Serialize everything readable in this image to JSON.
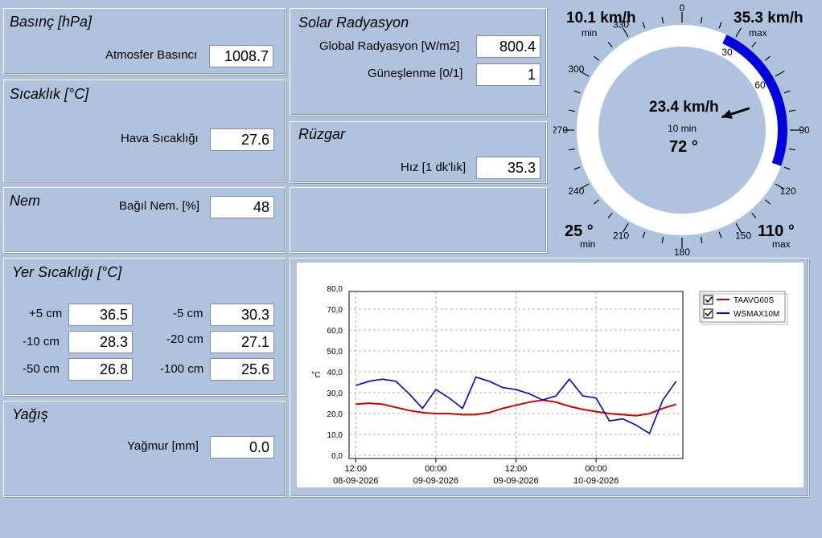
{
  "pressure": {
    "title": "Basınç [hPa]",
    "label": "Atmosfer Basıncı",
    "value": "1008.7"
  },
  "temperature": {
    "title": "Sıcaklık [°C]",
    "label": "Hava Sıcaklığı",
    "value": "27.6"
  },
  "humidity": {
    "title": "Nem",
    "label": "Bağıl Nem. [%]",
    "value": "48"
  },
  "solar": {
    "title": "Solar Radyasyon",
    "global_label": "Global Radyasyon [W/m2]",
    "global_value": "800.4",
    "sun_label": "Güneşlenme [0/1]",
    "sun_value": "1"
  },
  "wind": {
    "title": "Rüzgar",
    "speed_label": "Hız [1 dk'lık]",
    "speed_value": "35.3"
  },
  "soil": {
    "title": "Yer Sıcaklığı [°C]",
    "rows": [
      {
        "l1": "+5 cm",
        "v1": "36.5",
        "l2": "-5 cm",
        "v2": "30.3"
      },
      {
        "l1": "-10 cm",
        "v1": "28.3",
        "l2": "-20 cm",
        "v2": "27.1"
      },
      {
        "l1": "-50 cm",
        "v1": "26.8",
        "l2": "-100 cm",
        "v2": "25.6"
      }
    ]
  },
  "rain": {
    "title": "Yağış",
    "label": "Yağmur [mm]",
    "value": "0.0"
  },
  "gauge": {
    "min_speed": "10.1 km/h",
    "min_speed_caption": "min",
    "max_speed": "35.3 km/h",
    "max_speed_caption": "max",
    "current_speed": "23.4 km/h",
    "avg_caption": "10 min",
    "direction": "72 °",
    "min_dir": "25 °",
    "min_dir_caption": "min",
    "max_dir": "110 °",
    "max_dir_caption": "max",
    "tick_labels": [
      "0",
      "30",
      "60",
      "90",
      "120",
      "150",
      "180",
      "210",
      "240",
      "270",
      "300",
      "330"
    ],
    "range_start_deg": 25,
    "range_end_deg": 110,
    "needle_deg": 72,
    "range_color": "#0000e0"
  },
  "chart_data": {
    "type": "line",
    "ylabel": "°C",
    "ylim": [
      0,
      80
    ],
    "yticks": [
      "80,0",
      "70,0",
      "60,0",
      "50,0",
      "40,0",
      "30,0",
      "20,0",
      "10,0",
      "0,0"
    ],
    "xticks": [
      {
        "time": "12:00",
        "date": "08-09-2026"
      },
      {
        "time": "00:00",
        "date": "09-09-2026"
      },
      {
        "time": "12:00",
        "date": "09-09-2026"
      },
      {
        "time": "00:00",
        "date": "10-09-2026"
      }
    ],
    "x": [
      0,
      2,
      4,
      6,
      8,
      10,
      12,
      14,
      16,
      18,
      20,
      22,
      24,
      26,
      28,
      30,
      32,
      34,
      36,
      38,
      40,
      42,
      44,
      46,
      48
    ],
    "series": [
      {
        "name": "TAAVG60S",
        "color": "#cc0000",
        "values": [
          26,
          26.5,
          26,
          24.5,
          23,
          22,
          21.5,
          21.5,
          21,
          21,
          22,
          24,
          25.5,
          27,
          28,
          27,
          25,
          23.5,
          22.5,
          21.5,
          21,
          20.5,
          21.5,
          24,
          26
        ]
      },
      {
        "name": "WSMAX10M",
        "color": "#0000cc",
        "values": [
          35,
          37,
          38,
          37,
          31,
          24,
          33,
          29,
          24,
          39,
          37,
          34,
          33,
          31,
          28,
          30,
          38,
          30,
          29,
          18,
          19,
          16,
          12,
          28,
          37
        ]
      }
    ],
    "legend": "top-right"
  }
}
